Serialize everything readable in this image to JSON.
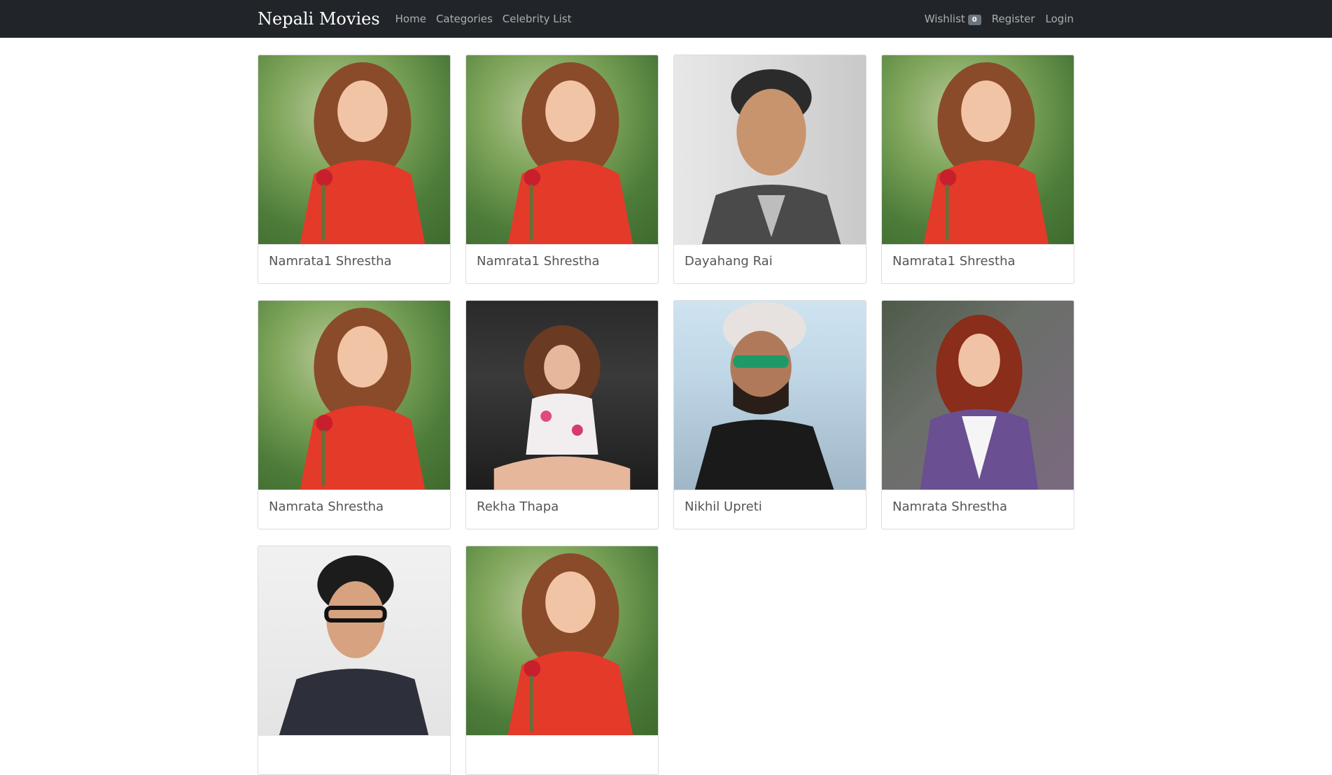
{
  "navbar": {
    "brand": "Nepali Movies",
    "links": [
      "Home",
      "Categories",
      "Celebrity List"
    ],
    "wishlist_label": "Wishlist",
    "wishlist_count": "0",
    "register_label": "Register",
    "login_label": "Login"
  },
  "celebrities": [
    {
      "name": "Namrata1 Shrestha"
    },
    {
      "name": "Namrata1 Shrestha"
    },
    {
      "name": "Dayahang Rai"
    },
    {
      "name": "Namrata1 Shrestha"
    },
    {
      "name": "Namrata Shrestha"
    },
    {
      "name": "Rekha Thapa"
    },
    {
      "name": "Nikhil Upreti"
    },
    {
      "name": "Namrata Shrestha"
    },
    {
      "name": ""
    },
    {
      "name": ""
    }
  ],
  "colors": {
    "navbar_bg": "#212529",
    "card_border": "#dcdcdc",
    "title_text": "#555555",
    "badge_bg": "#6c757d"
  }
}
